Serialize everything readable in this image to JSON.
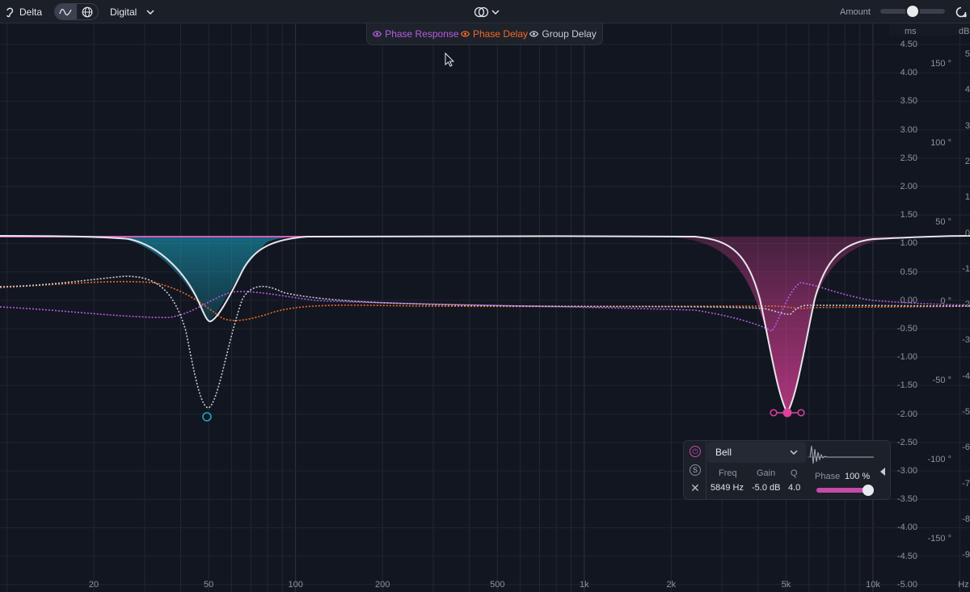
{
  "toolbar": {
    "delta_label": "Delta",
    "mode_label": "Digital",
    "amount_label": "Amount",
    "amount_level": 0.5
  },
  "legend": {
    "phase_response": "Phase Response",
    "phase_delay": "Phase Delay",
    "group_delay": "Group Delay"
  },
  "scales": {
    "ms_unit": "ms",
    "db_unit": "dB",
    "hz_unit": "Hz",
    "ms_ticks": [
      "4.50",
      "4.00",
      "3.50",
      "3.00",
      "2.50",
      "2.00",
      "1.50",
      "1.00",
      "0.50",
      "0.00",
      "-0.50",
      "-1.00",
      "-1.50",
      "-2.00",
      "-2.50",
      "-3.00",
      "-3.50",
      "-4.00",
      "-4.50",
      "-5.00"
    ],
    "deg_ticks": [
      "150 °",
      "100 °",
      "50 °",
      "0 °",
      "-50 °",
      "-100 °",
      "-150 °"
    ],
    "db_ticks": [
      "5",
      "4",
      "3",
      "2",
      "1",
      "0",
      "-1",
      "-2",
      "-3",
      "-4",
      "-5",
      "-6",
      "-7",
      "-8",
      "-9"
    ],
    "hz_ticks": [
      "20",
      "50",
      "100",
      "200",
      "500",
      "1k",
      "2k",
      "5k",
      "10k"
    ]
  },
  "band": {
    "type": "Bell",
    "freq_label": "Freq",
    "gain_label": "Gain",
    "q_label": "Q",
    "freq_value": "5849 Hz",
    "gain_value": "-5.0 dB",
    "q_value": "4.0",
    "phase_label": "Phase",
    "phase_value": "100 %",
    "phase_level": 1.0
  },
  "colors": {
    "phase_response": "#b45de0",
    "phase_delay": "#f06a24",
    "group_delay": "#c8ccd4",
    "band1": "#1aa7c4",
    "band2": "#e0409a",
    "curve": "#e8e6ea"
  }
}
